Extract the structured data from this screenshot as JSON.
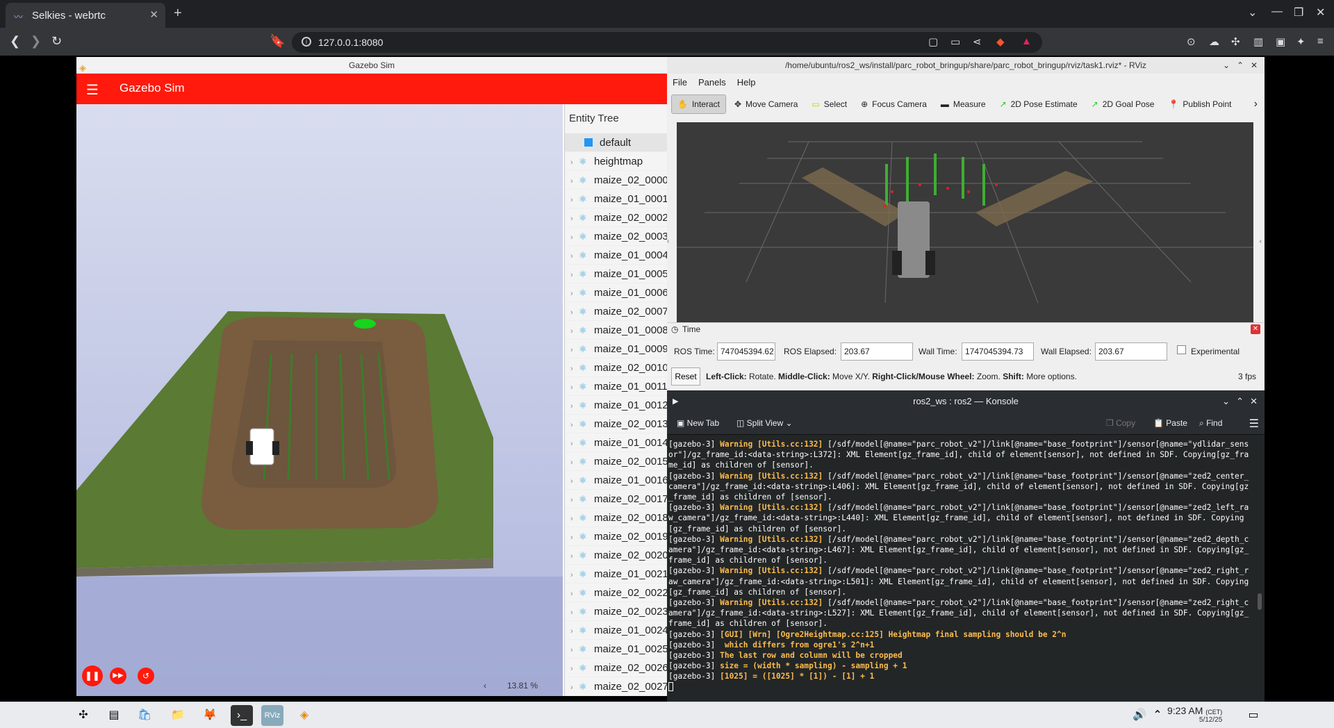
{
  "browser": {
    "tab_title": "Selkies - webrtc",
    "url": "127.0.0.1:8080"
  },
  "gazebo": {
    "window_title": "Gazebo Sim",
    "header_title": "Gazebo Sim",
    "entity_tree_title": "Entity Tree",
    "entities": [
      "default",
      "heightmap",
      "maize_02_0000",
      "maize_01_0001",
      "maize_02_0002",
      "maize_02_0003",
      "maize_01_0004",
      "maize_01_0005",
      "maize_01_0006",
      "maize_02_0007",
      "maize_01_0008",
      "maize_01_0009",
      "maize_02_0010",
      "maize_01_0011",
      "maize_01_0012",
      "maize_02_0013",
      "maize_01_0014",
      "maize_02_0015",
      "maize_01_0016",
      "maize_02_0017",
      "maize_02_0018",
      "maize_02_0019",
      "maize_02_0020",
      "maize_01_0021",
      "maize_02_0022",
      "maize_02_0023",
      "maize_01_0024",
      "maize_01_0025",
      "maize_02_0026",
      "maize_02_0027"
    ],
    "zoom": "13.81 %"
  },
  "rviz": {
    "window_title": "/home/ubuntu/ros2_ws/install/parc_robot_bringup/share/parc_robot_bringup/rviz/task1.rviz* - RViz",
    "menu": [
      "File",
      "Panels",
      "Help"
    ],
    "tools": [
      "Interact",
      "Move Camera",
      "Select",
      "Focus Camera",
      "Measure",
      "2D Pose Estimate",
      "2D Goal Pose",
      "Publish Point"
    ],
    "time_panel": {
      "title": "Time",
      "ros_time_label": "ROS Time:",
      "ros_time": "747045394.62",
      "ros_elapsed_label": "ROS Elapsed:",
      "ros_elapsed": "203.67",
      "wall_time_label": "Wall Time:",
      "wall_time": "1747045394.73",
      "wall_elapsed_label": "Wall Elapsed:",
      "wall_elapsed": "203.67",
      "experimental": "Experimental"
    },
    "reset": "Reset",
    "status_lc": "Left-Click:",
    "status_lc_t": " Rotate. ",
    "status_mc": "Middle-Click:",
    "status_mc_t": " Move X/Y. ",
    "status_rc": "Right-Click/Mouse Wheel:",
    "status_rc_t": " Zoom. ",
    "status_sh": "Shift:",
    "status_sh_t": " More options.",
    "fps": "3 fps"
  },
  "konsole": {
    "window_title": "ros2_ws : ros2 — Konsole",
    "new_tab": "New Tab",
    "split_view": "Split View",
    "copy": "Copy",
    "paste": "Paste",
    "find": "Find"
  },
  "terminal_lines": [
    {
      "p": "[gazebo-3] ",
      "w": "Warning [Utils.cc:132] ",
      "t": "[/sdf/model[@name=\"parc_robot_v2\"]/link[@name=\"base_footprint\"]/sensor[@name=\"ydlidar_sensor\"]/gz_frame_id:<data-string>:L372]: XML Element[gz_frame_id], child of element[sensor], not defined in SDF. Copying[gz_frame_id] as children of [sensor]."
    },
    {
      "p": "[gazebo-3] ",
      "w": "Warning [Utils.cc:132] ",
      "t": "[/sdf/model[@name=\"parc_robot_v2\"]/link[@name=\"base_footprint\"]/sensor[@name=\"zed2_center_camera\"]/gz_frame_id:<data-string>:L406]: XML Element[gz_frame_id], child of element[sensor], not defined in SDF. Copying[gz_frame_id] as children of [sensor]."
    },
    {
      "p": "[gazebo-3] ",
      "w": "Warning [Utils.cc:132] ",
      "t": "[/sdf/model[@name=\"parc_robot_v2\"]/link[@name=\"base_footprint\"]/sensor[@name=\"zed2_left_raw_camera\"]/gz_frame_id:<data-string>:L440]: XML Element[gz_frame_id], child of element[sensor], not defined in SDF. Copying[gz_frame_id] as children of [sensor]."
    },
    {
      "p": "[gazebo-3] ",
      "w": "Warning [Utils.cc:132] ",
      "t": "[/sdf/model[@name=\"parc_robot_v2\"]/link[@name=\"base_footprint\"]/sensor[@name=\"zed2_depth_camera\"]/gz_frame_id:<data-string>:L467]: XML Element[gz_frame_id], child of element[sensor], not defined in SDF. Copying[gz_frame_id] as children of [sensor]."
    },
    {
      "p": "[gazebo-3] ",
      "w": "Warning [Utils.cc:132] ",
      "t": "[/sdf/model[@name=\"parc_robot_v2\"]/link[@name=\"base_footprint\"]/sensor[@name=\"zed2_right_raw_camera\"]/gz_frame_id:<data-string>:L501]: XML Element[gz_frame_id], child of element[sensor], not defined in SDF. Copying[gz_frame_id] as children of [sensor]."
    },
    {
      "p": "[gazebo-3] ",
      "w": "Warning [Utils.cc:132] ",
      "t": "[/sdf/model[@name=\"parc_robot_v2\"]/link[@name=\"base_footprint\"]/sensor[@name=\"zed2_right_camera\"]/gz_frame_id:<data-string>:L527]: XML Element[gz_frame_id], child of element[sensor], not defined in SDF. Copying[gz_frame_id] as children of [sensor]."
    },
    {
      "p": "[gazebo-3] ",
      "w": "[GUI] [Wrn] [Ogre2Heightmap.cc:125] Heightmap final sampling should be 2^n",
      "t": ""
    },
    {
      "p": "[gazebo-3] ",
      "w": " which differs from ogre1's 2^n+1",
      "t": ""
    },
    {
      "p": "[gazebo-3] ",
      "w": "The last row and column will be cropped",
      "t": ""
    },
    {
      "p": "[gazebo-3] ",
      "w": "size = (width * sampling) - sampling + 1",
      "t": ""
    },
    {
      "p": "[gazebo-3] ",
      "w": "[1025] = ([1025] * [1]) - [1] + 1",
      "t": ""
    }
  ],
  "clock": {
    "time": "9:23 AM",
    "tz": "(CET)",
    "date": "5/12/25"
  }
}
